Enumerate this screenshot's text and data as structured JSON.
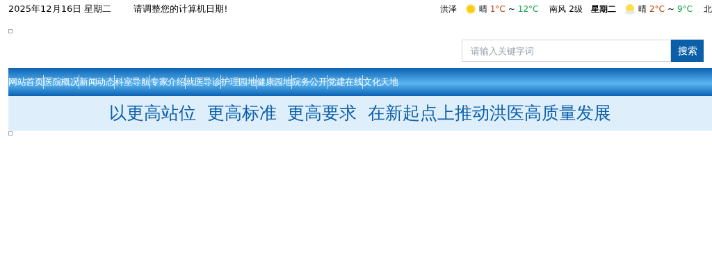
{
  "top_bar": {
    "date": "2025年12月16日 星期二",
    "notice": "请调整您的计算机日期!"
  },
  "weather": {
    "city": "洪泽",
    "days": [
      {
        "kind": "sun",
        "condition": "晴",
        "low": "1°C",
        "sep": "~",
        "high": "12°C",
        "wind": "南风 2级"
      },
      {
        "day": "星期二",
        "kind": "sun-cloud",
        "condition": "晴",
        "low": "2°C",
        "sep": "~",
        "high": "9°C",
        "wind": "北"
      }
    ]
  },
  "search": {
    "placeholder": "请输入关键字词",
    "button": "搜索"
  },
  "nav": [
    {
      "label": "网站首页"
    },
    {
      "label": "医院概况"
    },
    {
      "label": "新闻动态"
    },
    {
      "label": "科室导航"
    },
    {
      "label": "专家介绍"
    },
    {
      "label": "就医导诊"
    },
    {
      "label": "护理园地"
    },
    {
      "label": "健康园地"
    },
    {
      "label": "院务公开"
    },
    {
      "label": "党建在线"
    },
    {
      "label": "文化天地"
    }
  ],
  "banner": {
    "slogan": "以更高站位  更高标准  更高要求  在新起点上推动洪医高质量发展"
  }
}
